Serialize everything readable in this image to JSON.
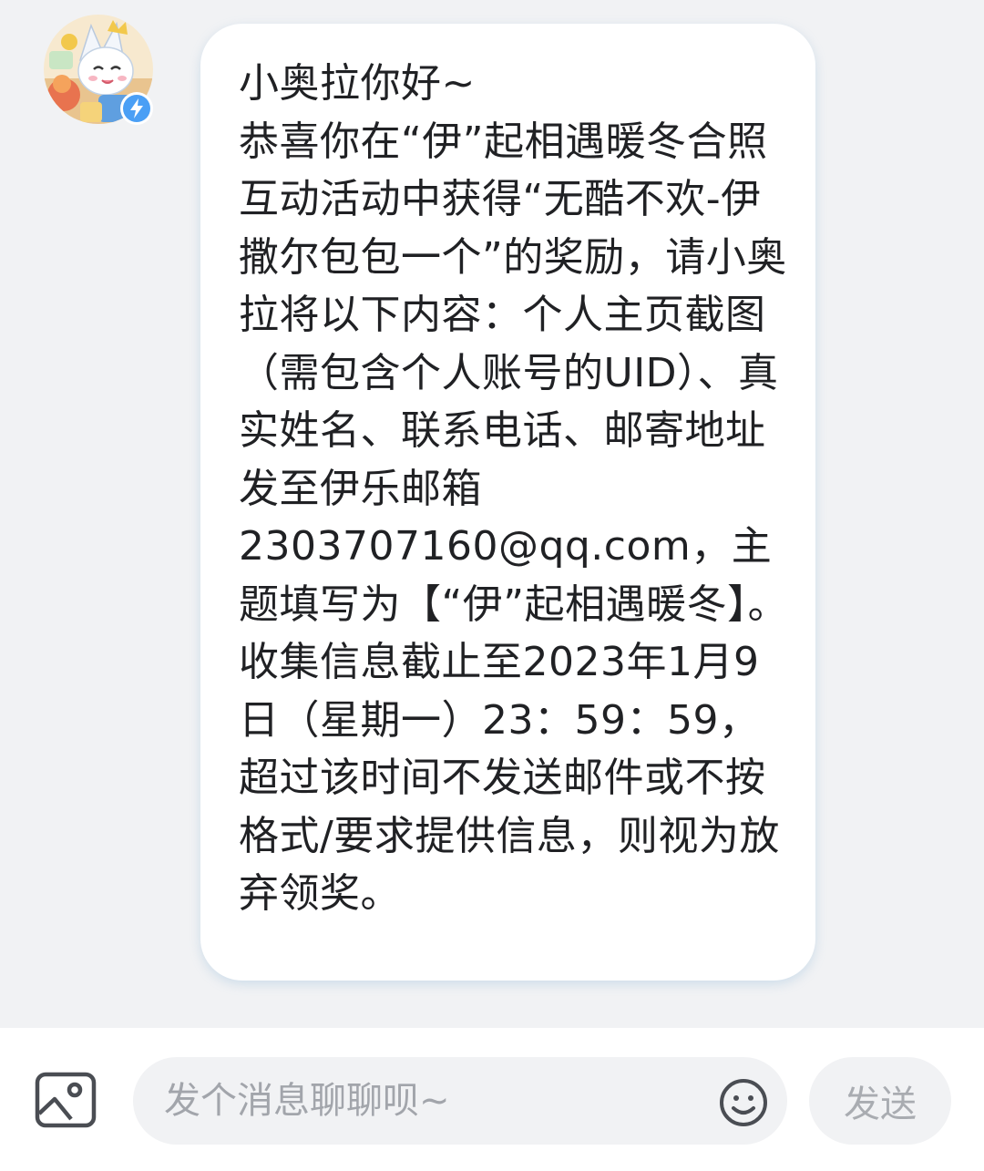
{
  "chat": {
    "sender_avatar": "cat-mascot-avatar",
    "verified_badge_icon": "lightning-badge-icon",
    "message": {
      "text": "小奥拉你好~\n恭喜你在“伊”起相遇暖冬合照互动活动中获得“无酷不欢-伊撒尔包包一个”的奖励，请小奥拉将以下内容：个人主页截图（需包含个人账号的UID）、真实姓名、联系电话、邮寄地址发至伊乐邮箱\n2303707160@qq.com，主题填写为【“伊”起相遇暖冬】。收集信息截止至2023年1月9日（星期一）23：59：59，超过该时间不发送邮件或不按格式/要求提供信息，则视为放弃领奖。"
    }
  },
  "input_bar": {
    "image_icon": "image-icon",
    "placeholder": "发个消息聊聊呗~",
    "emoji_icon": "emoji-icon",
    "send_label": "发送"
  },
  "colors": {
    "background": "#f1f2f4",
    "bubble": "#ffffff",
    "text": "#202124",
    "placeholder": "#a2a5ab",
    "badge": "#4a9ff5"
  }
}
